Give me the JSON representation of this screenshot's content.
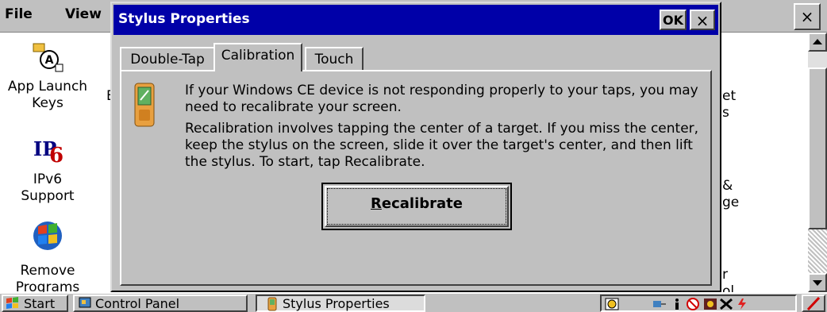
{
  "control_panel": {
    "menu": {
      "file": "File",
      "view": "View"
    },
    "close_glyph": "×",
    "items": [
      {
        "label_line1": "App Launch",
        "label_line2": "Keys"
      },
      {
        "label_line1": "IPv6",
        "label_line2": "Support"
      },
      {
        "label_line1": "Remove",
        "label_line2": "Programs"
      }
    ],
    "partial_col2": [
      "E"
    ],
    "partial_right": [
      "et",
      "s",
      "&",
      "ge",
      "r",
      "ol"
    ]
  },
  "dialog": {
    "title": "Stylus Properties",
    "ok_label": "OK",
    "close_glyph": "×",
    "tabs": [
      {
        "label": "Double-Tap",
        "active": false
      },
      {
        "label": "Calibration",
        "active": true
      },
      {
        "label": "Touch",
        "active": false
      }
    ],
    "paragraph1": "If your Windows CE device is not responding properly to your taps, you may need to recalibrate your screen.",
    "paragraph2": "Recalibration involves tapping the center of a target. If you miss the center, keep the stylus on the screen, slide it over the target's center, and then lift the stylus. To start, tap Recalibrate.",
    "recalibrate_label_first": "R",
    "recalibrate_label_rest": "ecalibrate"
  },
  "taskbar": {
    "start_label": "Start",
    "tasks": [
      {
        "label": "Control Panel",
        "active": false
      },
      {
        "label": "Stylus Properties",
        "active": true
      }
    ],
    "tray_icons": [
      "keyboard-icon",
      "network-icon",
      "info-icon",
      "no-sync-icon",
      "app-icon",
      "disconnect-icon",
      "battery-icon",
      "stylus-icon"
    ]
  },
  "colors": {
    "title_bar": "#0000a8",
    "face": "#c0c0c0"
  }
}
